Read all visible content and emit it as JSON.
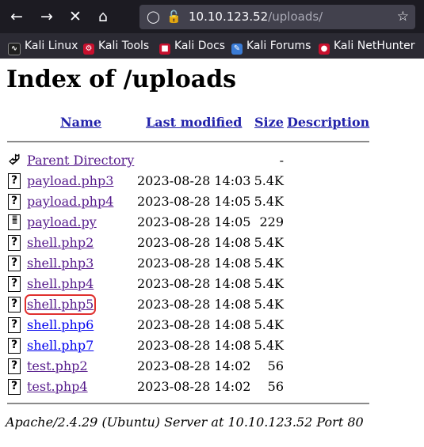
{
  "browser": {
    "url_host": "10.10.123.52",
    "url_path": "/uploads/",
    "bookmarks": [
      {
        "label": "Kali Linux",
        "icon": "kali-dragon-icon",
        "color": "#1f1f1f"
      },
      {
        "label": "Kali Tools",
        "icon": "kali-tools-icon",
        "color": "#c8102e"
      },
      {
        "label": "Kali Docs",
        "icon": "kali-docs-icon",
        "color": "#c8102e"
      },
      {
        "label": "Kali Forums",
        "icon": "kali-forums-icon",
        "color": "#3a7bd5"
      },
      {
        "label": "Kali NetHunter",
        "icon": "kali-nethunter-icon",
        "color": "#c8102e"
      }
    ]
  },
  "page": {
    "title": "Index of /uploads",
    "headers": {
      "name": "Name",
      "last_modified": "Last modified",
      "size": "Size",
      "description": "Description"
    },
    "parent": {
      "name": "Parent Directory",
      "size": "-"
    },
    "files": [
      {
        "name": "payload.php3",
        "date": "2023-08-28 14:03",
        "size": "5.4K",
        "icon": "unknown-file-icon"
      },
      {
        "name": "payload.php4",
        "date": "2023-08-28 14:05",
        "size": "5.4K",
        "icon": "unknown-file-icon"
      },
      {
        "name": "payload.py",
        "date": "2023-08-28 14:05",
        "size": "229",
        "icon": "text-file-icon"
      },
      {
        "name": "shell.php2",
        "date": "2023-08-28 14:08",
        "size": "5.4K",
        "icon": "unknown-file-icon"
      },
      {
        "name": "shell.php3",
        "date": "2023-08-28 14:08",
        "size": "5.4K",
        "icon": "unknown-file-icon"
      },
      {
        "name": "shell.php4",
        "date": "2023-08-28 14:08",
        "size": "5.4K",
        "icon": "unknown-file-icon"
      },
      {
        "name": "shell.php5",
        "date": "2023-08-28 14:08",
        "size": "5.4K",
        "icon": "unknown-file-icon"
      },
      {
        "name": "shell.php6",
        "date": "2023-08-28 14:08",
        "size": "5.4K",
        "icon": "unknown-file-icon"
      },
      {
        "name": "shell.php7",
        "date": "2023-08-28 14:08",
        "size": "5.4K",
        "icon": "unknown-file-icon"
      },
      {
        "name": "test.php2",
        "date": "2023-08-28 14:02",
        "size": "56",
        "icon": "unknown-file-icon"
      },
      {
        "name": "test.php4",
        "date": "2023-08-28 14:02",
        "size": "56",
        "icon": "unknown-file-icon"
      }
    ],
    "footer": "Apache/2.4.29 (Ubuntu) Server at 10.10.123.52 Port 80"
  },
  "colors": {
    "visited_link": "#551a8b",
    "unvisited_link": "#0000ee",
    "highlight_outline": "#e0302e",
    "toolbar_bg": "#1c1b22"
  }
}
